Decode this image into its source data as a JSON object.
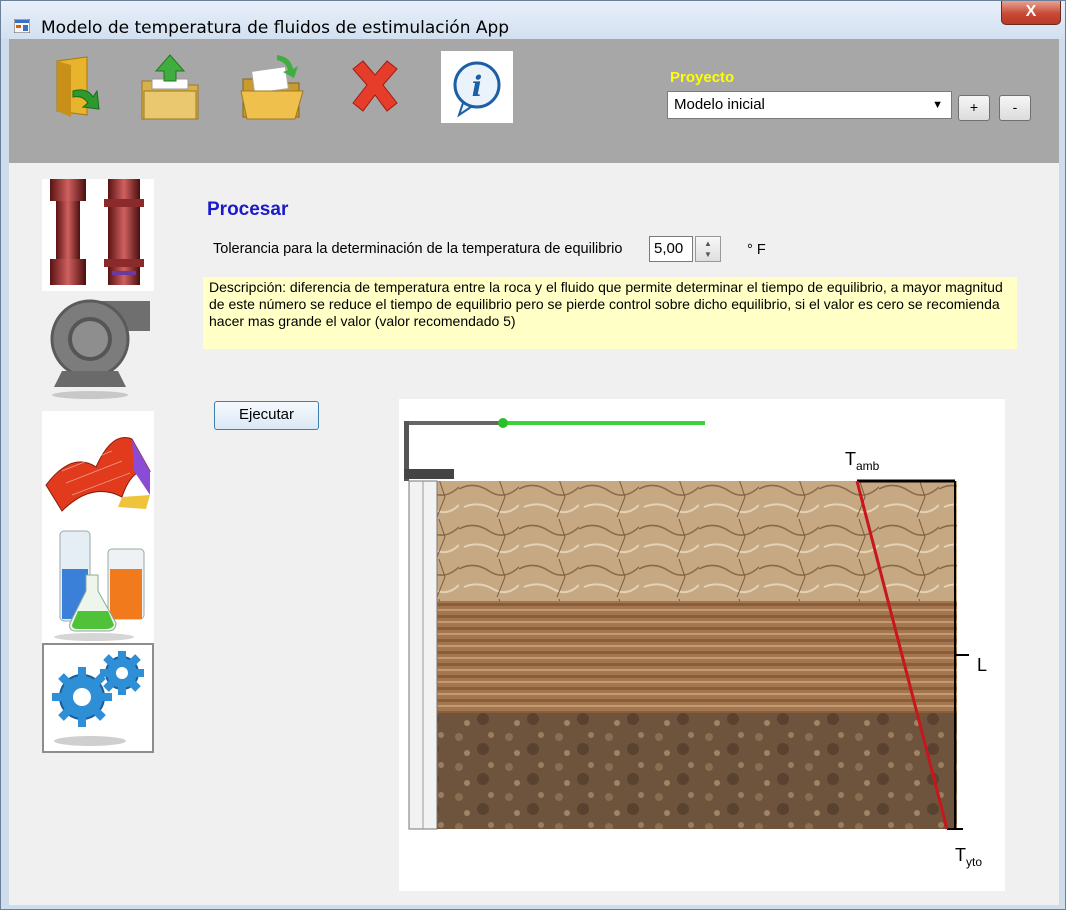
{
  "window": {
    "title": "Modelo de temperatura de fluidos de estimulación App",
    "close_glyph": "X"
  },
  "toolbar": {
    "buttons": [
      {
        "icon": "folder-exit-icon"
      },
      {
        "icon": "folder-upload-icon"
      },
      {
        "icon": "folder-open-icon"
      },
      {
        "icon": "delete-x-icon"
      },
      {
        "icon": "info-icon"
      }
    ],
    "project_label": "Proyecto",
    "project_value": "Modelo inicial",
    "add_label": "+",
    "remove_label": "-"
  },
  "sidebar": {
    "items": [
      {
        "icon": "pipe-tubing-icon"
      },
      {
        "icon": "pump-icon"
      },
      {
        "icon": "surface-3d-plot-icon"
      },
      {
        "icon": "lab-flasks-icon"
      },
      {
        "icon": "gears-icon",
        "selected": true
      }
    ]
  },
  "main": {
    "section_title": "Procesar",
    "tolerance_label": "Tolerancia para la determinación de la temperatura de equilibrio",
    "tolerance_value": "5,00",
    "tolerance_unit": "° F",
    "description": "Descripción: diferencia de temperatura entre la roca y el fluido que permite determinar el tiempo de equilibrio, a mayor magnitud de este número se reduce el tiempo de equilibrio pero se pierde control sobre dicho equilibrio, si el valor es cero se recomienda hacer mas grande el valor (valor recomendado 5)",
    "run_label": "Ejecutar"
  },
  "diagram": {
    "t_top_base": "T",
    "t_top_sub": "amb",
    "t_bottom_base": "T",
    "t_bottom_sub": "yto",
    "length_label": "L",
    "colors": {
      "gradient_line": "#c8161c",
      "progress": "#3ed13e"
    }
  }
}
